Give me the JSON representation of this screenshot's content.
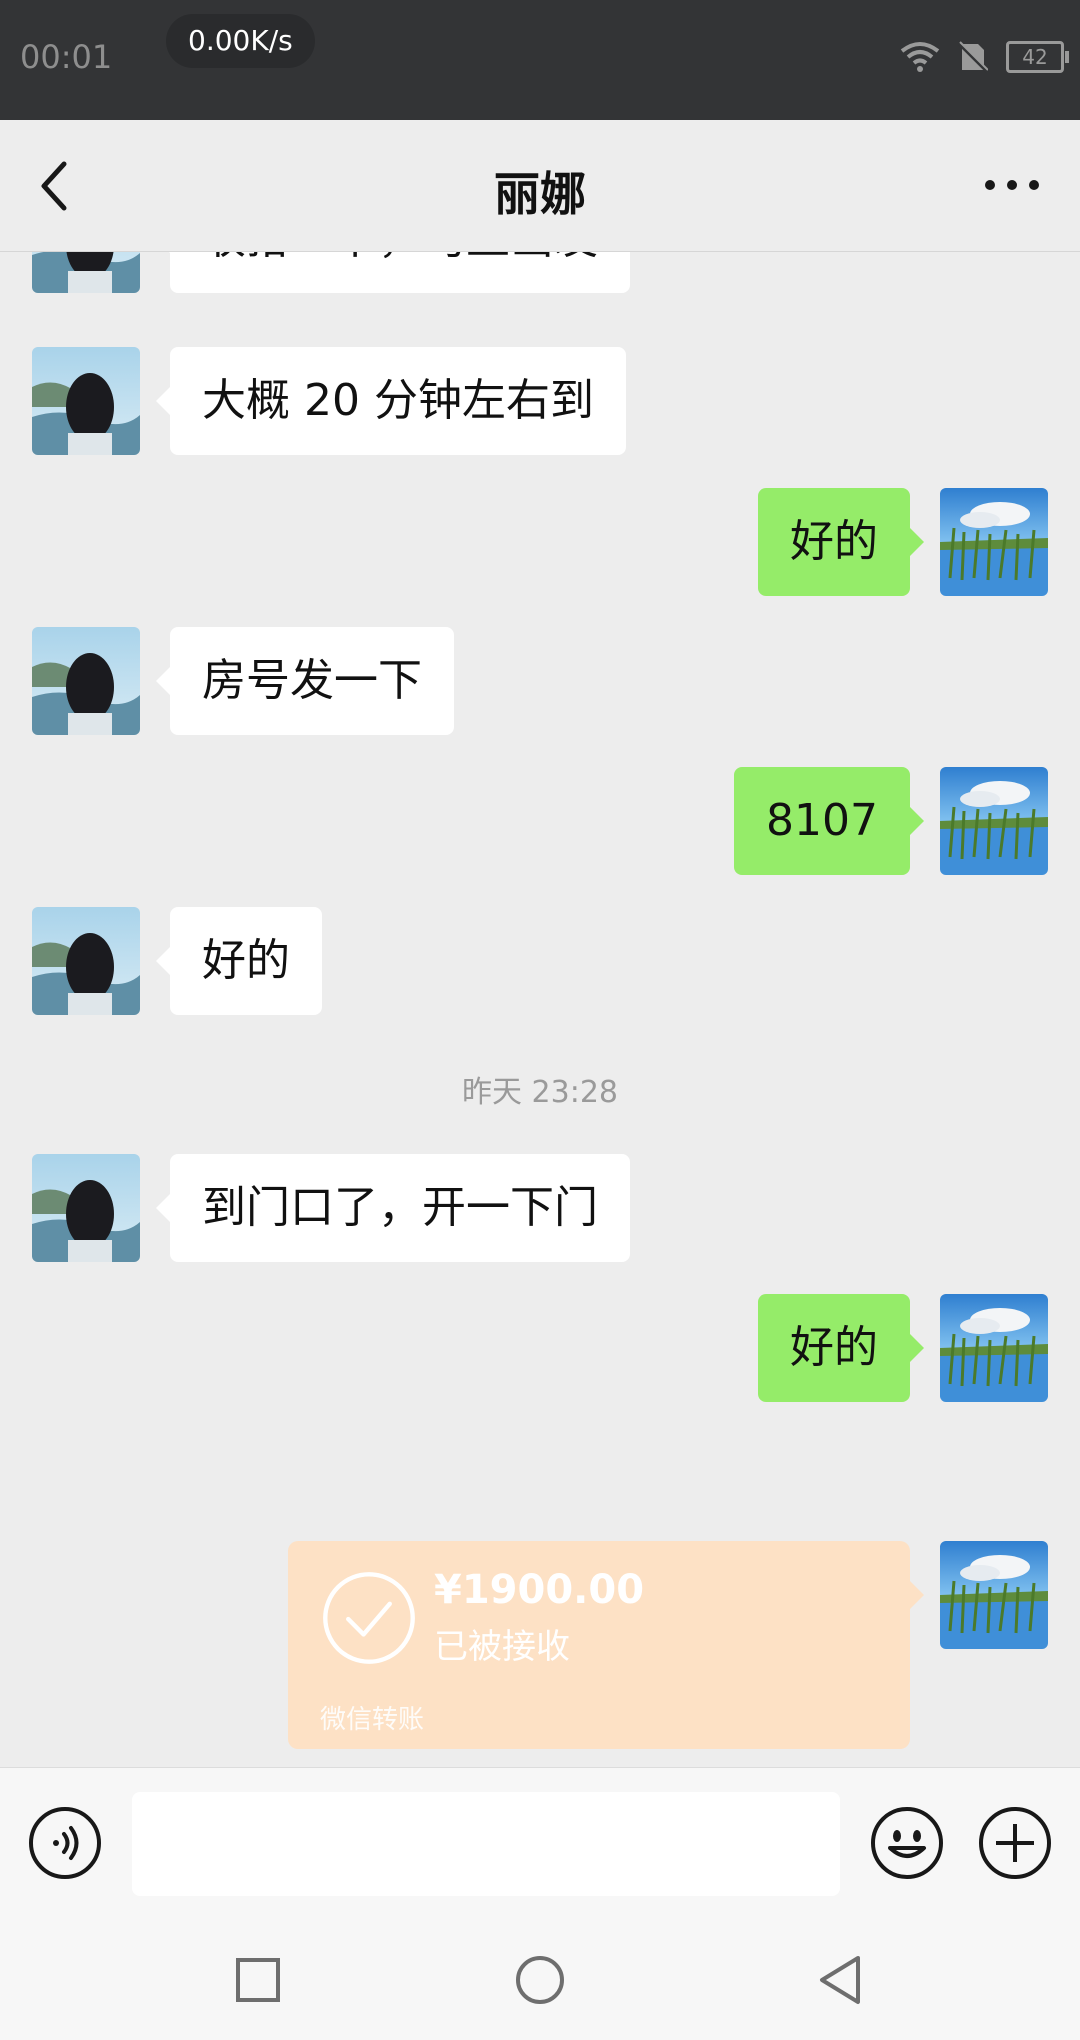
{
  "status_bar": {
    "time": "00:01",
    "net_speed": "0.00K/s",
    "battery": "42"
  },
  "header": {
    "title": "丽娜"
  },
  "messages": [
    {
      "side": "in",
      "text": "收拾一下，马上出发"
    },
    {
      "side": "in",
      "text": "大概 20 分钟左右到"
    },
    {
      "side": "out",
      "text": "好的"
    },
    {
      "side": "in",
      "text": "房号发一下"
    },
    {
      "side": "out",
      "text": "8107"
    },
    {
      "side": "in",
      "text": "好的"
    },
    {
      "type": "timestamp",
      "text": "昨天 23:28"
    },
    {
      "side": "in",
      "text": "到门口了，开一下门"
    },
    {
      "side": "out",
      "text": "好的"
    }
  ],
  "transfer": {
    "amount": "¥1900.00",
    "status": "已被接收",
    "label": "微信转账"
  },
  "input": {
    "value": ""
  },
  "icons": {
    "back": "chevron-left-icon",
    "more": "more-dots-icon",
    "voice": "voice-icon",
    "emoji": "emoji-icon",
    "plus": "plus-icon",
    "nav_recent": "square-icon",
    "nav_home": "circle-icon",
    "nav_back": "triangle-back-icon"
  },
  "colors": {
    "status_bar": "#333436",
    "chat_bg": "#ededed",
    "outgoing_bubble": "#95ec69",
    "incoming_bubble": "#ffffff",
    "transfer_card": "#fde1c5"
  }
}
